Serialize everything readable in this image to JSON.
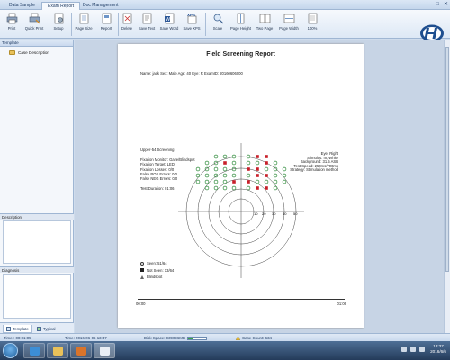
{
  "tabs": [
    "Data Sample",
    "Exam Report",
    "Doc Management"
  ],
  "ribbon": [
    {
      "label": "Print",
      "icon": "printer-icon"
    },
    {
      "label": "Quick Print",
      "icon": "quick-print-icon"
    },
    {
      "label": "Setup",
      "icon": "setup-icon"
    },
    {
      "label": "Page Size",
      "icon": "page-size-icon"
    },
    {
      "label": "Report",
      "icon": "report-icon"
    },
    {
      "label": "Delete",
      "icon": "delete-icon"
    },
    {
      "label": "Save Text",
      "icon": "save-text-icon"
    },
    {
      "label": "Save Word",
      "icon": "save-word-icon"
    },
    {
      "label": "Save XPS",
      "icon": "save-xps-icon"
    },
    {
      "label": "Scale",
      "icon": "scale-icon"
    },
    {
      "label": "Page Height",
      "icon": "page-height-icon"
    },
    {
      "label": "Two Page",
      "icon": "two-page-icon"
    },
    {
      "label": "Page Width",
      "icon": "page-width-icon"
    },
    {
      "label": "100%",
      "icon": "zoom-100-icon"
    }
  ],
  "left": {
    "template_header": "Template",
    "tree_item": "Case Description",
    "description_header": "Description",
    "diagnosis_header": "Diagnosis",
    "tabs": [
      "Template",
      "Typical"
    ]
  },
  "report": {
    "title": "Field Screening Report",
    "patient": "Name: jack  Sex: Male  Age: 40  Eye: R  ExamID: 20160606000",
    "left_lines": [
      "Upper-54 Screening",
      "",
      "Fixation Monitor: Gaze/Blindspot",
      "Fixation Target: LED",
      "Fixation Losses: 0/0",
      "False POS Errors: 0/0",
      "False NEG Errors: 0/0",
      "",
      "Test Duration: 01:06"
    ],
    "right_lines": [
      "Eye: Right",
      "Stimulus: III, White",
      "Background: 31.5 ASB",
      "Test Speed: 250ms/700ms",
      "Strategy: Stimulation method"
    ],
    "axis_ticks": [
      "10",
      "20",
      "30",
      "40",
      "50",
      "60"
    ],
    "legend": [
      {
        "symbol": "circle",
        "label": "Seen: 51/64"
      },
      {
        "symbol": "square",
        "label": "Not Seen: 13/64"
      },
      {
        "symbol": "triangle",
        "label": "Blindspot"
      }
    ],
    "timeline_start": "00:00",
    "timeline_end": "01:06"
  },
  "status": {
    "timer": "Timer: 00:01:05",
    "datetime": "Time: 2016-06-06 13:37",
    "disk": "Disk Space: 939096MB",
    "disk_fill": 0.25,
    "cases": "Case Count: 634"
  },
  "clock": {
    "time": "13:37",
    "date": "2016/6/6"
  },
  "colors": {
    "seen": "#2e8b3a",
    "not_seen": "#c8202a",
    "accent": "#1f4f8f"
  }
}
